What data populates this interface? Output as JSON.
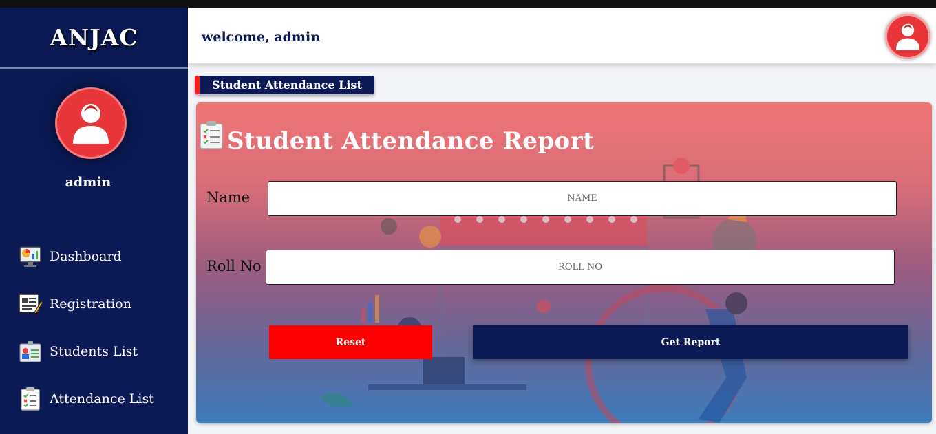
{
  "sidebar": {
    "brand": "ANJAC",
    "user_name": "admin",
    "items": [
      {
        "label": "Dashboard",
        "icon": "dashboard-icon"
      },
      {
        "label": "Registration",
        "icon": "registration-icon"
      },
      {
        "label": "Students List",
        "icon": "students-list-icon"
      },
      {
        "label": "Attendance List",
        "icon": "attendance-list-icon"
      }
    ]
  },
  "header": {
    "welcome_text": "welcome, admin",
    "avatar_icon": "user-avatar-icon"
  },
  "breadcrumb": "Student Attendance List",
  "report": {
    "title": "Student Attendance Report",
    "title_icon": "clipboard-icon",
    "name_label": "Name",
    "name_placeholder": "NAME",
    "name_value": "",
    "rollno_label": "Roll No",
    "rollno_placeholder": "ROLL NO",
    "rollno_value": "",
    "reset_label": "Reset",
    "get_report_label": "Get Report"
  },
  "colors": {
    "sidebar_bg": "#0b1a55",
    "accent_red": "#ff0000",
    "avatar_red": "#e8363a",
    "button_navy": "#0b1a55"
  }
}
